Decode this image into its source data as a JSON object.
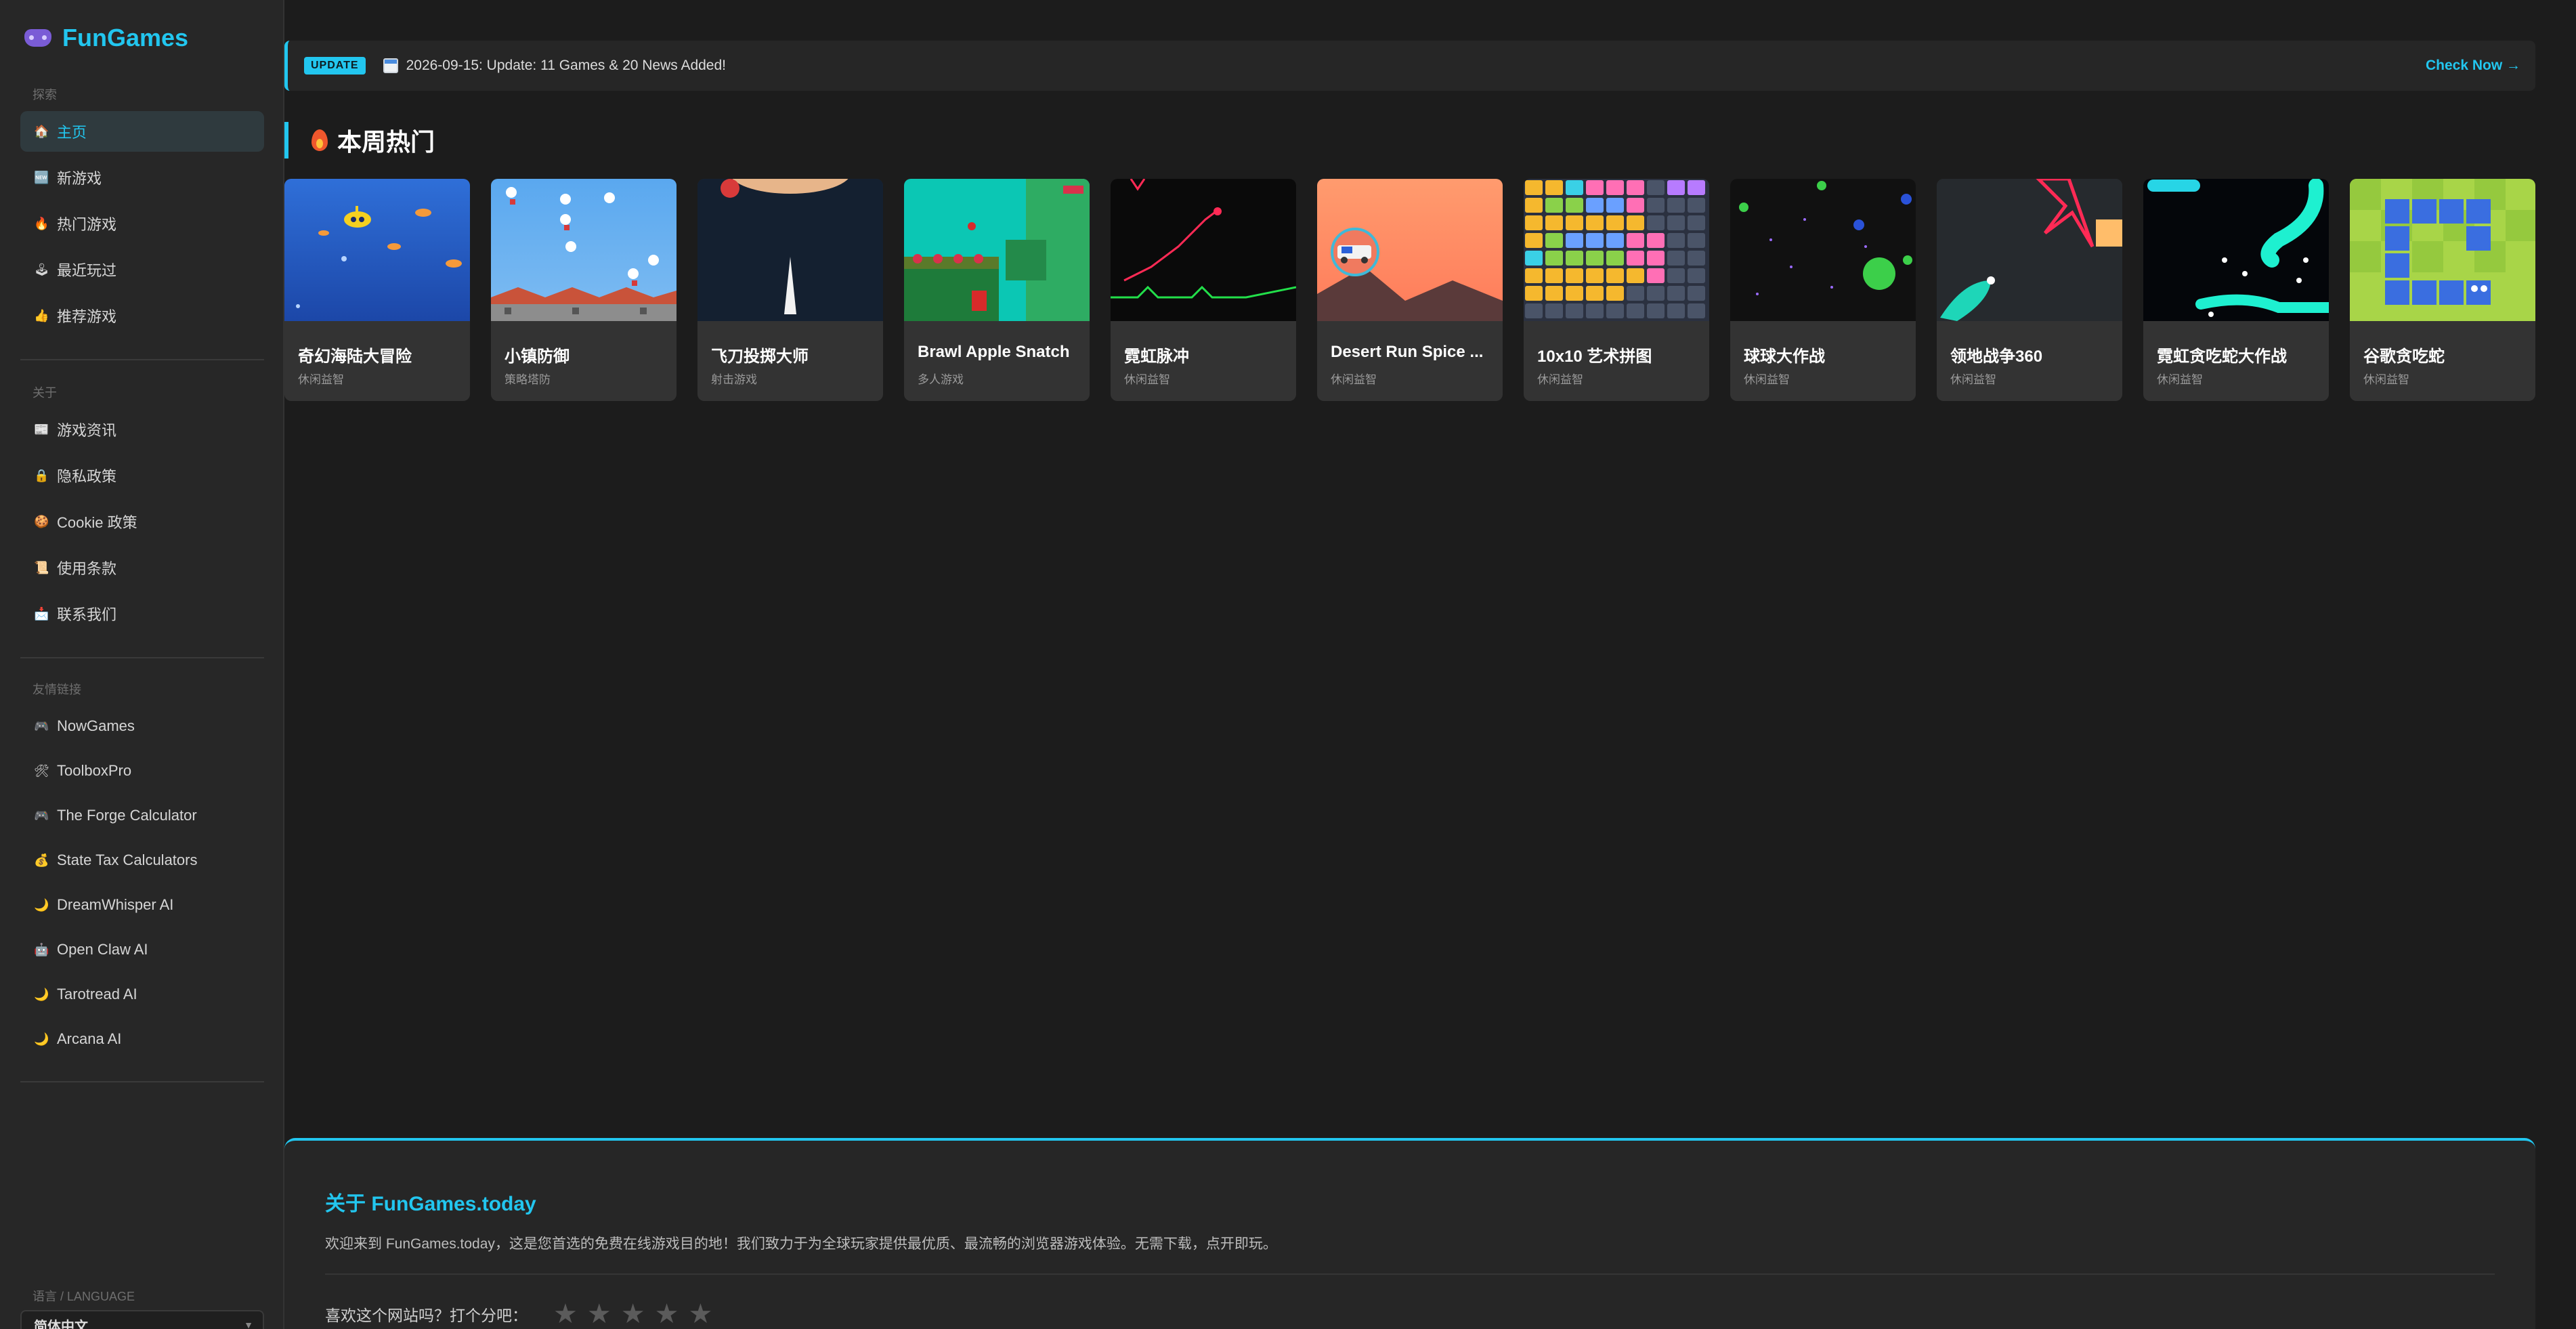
{
  "brand": {
    "name": "FunGames"
  },
  "sidebar": {
    "sections": [
      {
        "title": "探索",
        "items": [
          {
            "icon": "🏠",
            "label": "主页",
            "active": true
          },
          {
            "icon": "🆕",
            "label": "新游戏"
          },
          {
            "icon": "🔥",
            "label": "热门游戏"
          },
          {
            "icon": "🕹",
            "label": "最近玩过"
          },
          {
            "icon": "👍",
            "label": "推荐游戏"
          }
        ]
      },
      {
        "title": "关于",
        "items": [
          {
            "icon": "📰",
            "label": "游戏资讯"
          },
          {
            "icon": "🔒",
            "label": "隐私政策"
          },
          {
            "icon": "🍪",
            "label": "Cookie 政策"
          },
          {
            "icon": "📜",
            "label": "使用条款"
          },
          {
            "icon": "📩",
            "label": "联系我们"
          }
        ]
      },
      {
        "title": "友情链接",
        "items": [
          {
            "icon": "🎮",
            "label": "NowGames"
          },
          {
            "icon": "🛠",
            "label": "ToolboxPro"
          },
          {
            "icon": "🎮",
            "label": "The Forge Calculator"
          },
          {
            "icon": "💰",
            "label": "State Tax Calculators"
          },
          {
            "icon": "🌙",
            "label": "DreamWhisper AI"
          },
          {
            "icon": "🤖",
            "label": "Open Claw AI"
          },
          {
            "icon": "🌙",
            "label": "Tarotread AI"
          },
          {
            "icon": "🌙",
            "label": "Arcana AI"
          }
        ]
      }
    ],
    "language": {
      "title": "语言 / LANGUAGE",
      "value": "简体中文"
    }
  },
  "update": {
    "badge": "UPDATE",
    "text": "2026-09-15: Update: 11 Games & 20 News Added!",
    "link": "Check Now →"
  },
  "hot": {
    "title": "本周热门",
    "games": [
      {
        "name": "奇幻海陆大冒险",
        "category": "休闲益智"
      },
      {
        "name": "小镇防御",
        "category": "策略塔防"
      },
      {
        "name": "飞刀投掷大师",
        "category": "射击游戏"
      },
      {
        "name": "Brawl Apple Snatch",
        "category": "多人游戏"
      },
      {
        "name": "霓虹脉冲",
        "category": "休闲益智"
      },
      {
        "name": "Desert Run Spice ...",
        "category": "休闲益智"
      },
      {
        "name": "10x10 艺术拼图",
        "category": "休闲益智"
      },
      {
        "name": "球球大作战",
        "category": "休闲益智"
      },
      {
        "name": "领地战争360",
        "category": "休闲益智"
      },
      {
        "name": "霓虹贪吃蛇大作战",
        "category": "休闲益智"
      },
      {
        "name": "谷歌贪吃蛇",
        "category": "休闲益智"
      }
    ]
  },
  "about": {
    "title": "关于 FunGames.today",
    "text": "欢迎来到 FunGames.today，这是您首选的免费在线游戏目的地！我们致力于为全球玩家提供最优质、最流畅的浏览器游戏体验。无需下载，点开即玩。",
    "rate_label": "喜欢这个网站吗？打个分吧："
  },
  "colors": {
    "accent": "#22c6ef",
    "background": "#1c1c1c",
    "sidebar": "#272727",
    "card": "#333333"
  }
}
